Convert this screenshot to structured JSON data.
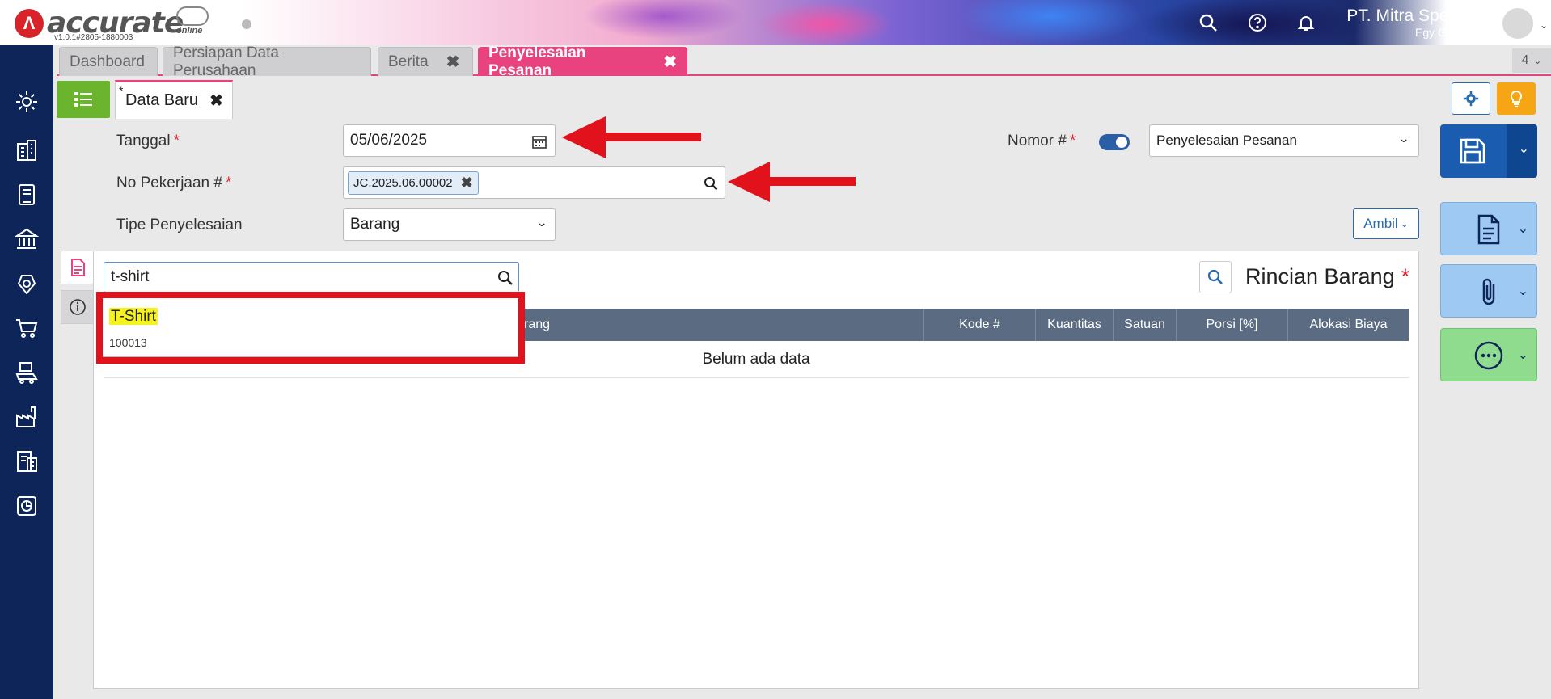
{
  "header": {
    "brand": "accurate",
    "brand_sub": "online",
    "version": "v1.0.1#2805-1880003",
    "company": "PT. Mitra Spesialis",
    "user": "Egy Gunawan"
  },
  "tabs": [
    {
      "label": "Dashboard"
    },
    {
      "label": "Persiapan Data Perusahaan"
    },
    {
      "label": "Berita"
    },
    {
      "label": "Penyelesaian Pesanan"
    }
  ],
  "tab_count": "4",
  "subtab": {
    "asterisk": "*",
    "label": "Data Baru"
  },
  "form": {
    "tanggal_label": "Tanggal",
    "tanggal_value": "05/06/2025",
    "no_pekerjaan_label": "No Pekerjaan #",
    "no_pekerjaan_tag": "JC.2025.06.00002",
    "tipe_label": "Tipe Penyelesaian",
    "tipe_value": "Barang",
    "nomor_label": "Nomor #",
    "nomor_value": "Penyelesaian Pesanan",
    "required_mark": "*",
    "ambil_label": "Ambil"
  },
  "detail": {
    "title": "Rincian Barang",
    "required_mark": "*",
    "search_value": "t-shirt",
    "columns": [
      "rang",
      "Kode #",
      "Kuantitas",
      "Satuan",
      "Porsi [%]",
      "Alokasi Biaya"
    ],
    "empty_text": "Belum ada data",
    "dropdown_item_name": "T-Shirt",
    "dropdown_item_code": "100013"
  },
  "colors": {
    "sidebar": "#0d2558",
    "accent_pink": "#e8437e",
    "highlight": "#f6f21e",
    "annotation_red": "#e1121c"
  }
}
